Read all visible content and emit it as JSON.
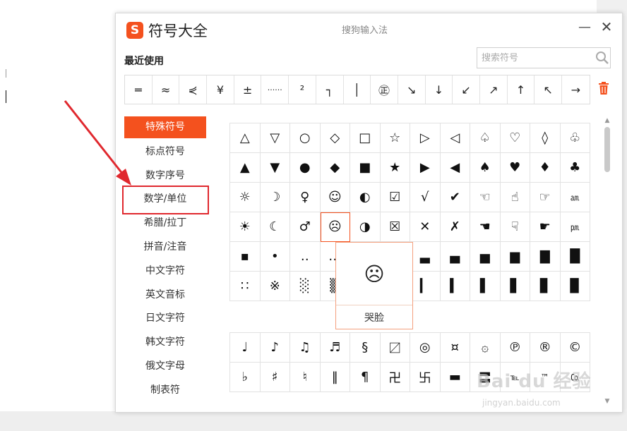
{
  "app": {
    "logo": "S",
    "title": "符号大全",
    "ime_name": "搜狗输入法",
    "minimize": "—",
    "close": "✕"
  },
  "recent": {
    "label": "最近使用",
    "symbols": [
      "═",
      "≈",
      "⋞",
      "¥",
      "±",
      "······",
      "²",
      "┐",
      "│",
      "㊣",
      "↘",
      "↓",
      "↙",
      "↗",
      "↑",
      "↖",
      "→"
    ]
  },
  "search": {
    "placeholder": "搜索符号"
  },
  "categories": [
    "特殊符号",
    "标点符号",
    "数字序号",
    "数学/单位",
    "希腊/拉丁",
    "拼音/注音",
    "中文字符",
    "英文音标",
    "日文字符",
    "韩文字符",
    "俄文字母",
    "制表符"
  ],
  "active_category": "特殊符号",
  "grid1": [
    [
      "△",
      "▽",
      "○",
      "◇",
      "□",
      "☆",
      "▷",
      "◁",
      "♤",
      "♡",
      "◊",
      "♧"
    ],
    [
      "▲",
      "▼",
      "●",
      "◆",
      "■",
      "★",
      "▶",
      "◀",
      "♠",
      "♥",
      "♦",
      "♣"
    ],
    [
      "☼",
      "☽",
      "♀",
      "☺",
      "◐",
      "☑",
      "√",
      "✔",
      "☜",
      "☝",
      "☞",
      "㏂"
    ],
    [
      "☀",
      "☾",
      "♂",
      "☹",
      "◑",
      "☒",
      "✕",
      "✗",
      "☚",
      "☟",
      "☛",
      "㏘"
    ],
    [
      "▪",
      "•",
      "‥",
      "…",
      "▁",
      "▂",
      "▃",
      "▄",
      "▅",
      "▆",
      "▇",
      "█"
    ],
    [
      "∷",
      "※",
      "░",
      "▒",
      "▓",
      "▏",
      "▎",
      "▍",
      "▌",
      "▋",
      "▊",
      "▉"
    ]
  ],
  "grid2": [
    [
      "♩",
      "♪",
      "♫",
      "♬",
      "§",
      "〼",
      "◎",
      "¤",
      "۞",
      "℗",
      "®",
      "©"
    ],
    [
      "♭",
      "♯",
      "♮",
      "‖",
      "¶",
      "卍",
      "卐",
      "▬",
      "〓",
      "℡",
      "™",
      "㏇"
    ]
  ],
  "tooltip": {
    "symbol": "☹",
    "label": "哭脸"
  },
  "watermark": {
    "main": "Bai du 经验",
    "sub": "jingyan.baidu.com"
  },
  "colors": {
    "accent": "#f4511e",
    "annotation": "#e0282e"
  }
}
